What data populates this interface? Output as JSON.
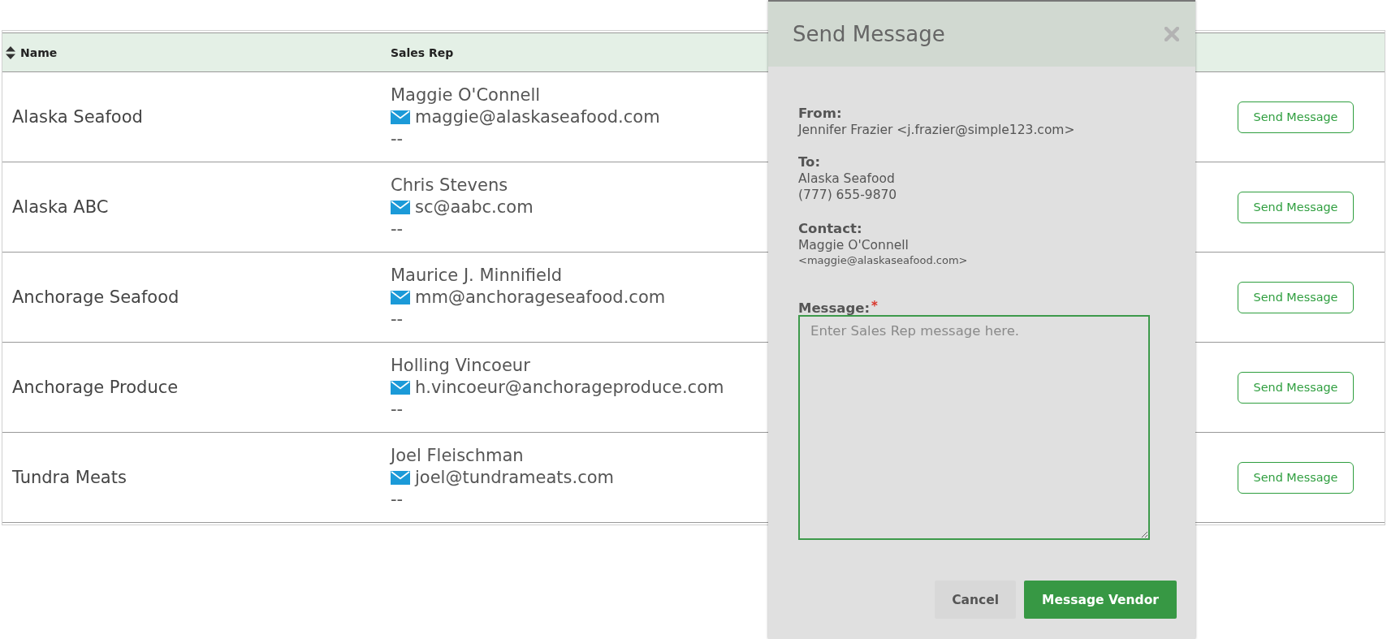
{
  "table": {
    "columns": [
      {
        "label": "Name",
        "sortable": true
      },
      {
        "label": "Sales Rep"
      }
    ],
    "rows": [
      {
        "name": "Alaska Seafood",
        "rep_name": "Maggie O'Connell",
        "rep_email": "maggie@alaskaseafood.com",
        "rep_phone": "--",
        "action": "Send Message"
      },
      {
        "name": "Alaska ABC",
        "rep_name": "Chris Stevens",
        "rep_email": "sc@aabc.com",
        "rep_phone": "--",
        "action": "Send Message"
      },
      {
        "name": "Anchorage Seafood",
        "rep_name": "Maurice J. Minnifield",
        "rep_email": "mm@anchorageseafood.com",
        "rep_phone": "--",
        "action": "Send Message"
      },
      {
        "name": "Anchorage Produce",
        "rep_name": "Holling Vincoeur",
        "rep_email": "h.vincoeur@anchorageproduce.com",
        "rep_phone": "--",
        "action": "Send Message"
      },
      {
        "name": "Tundra Meats",
        "rep_name": "Joel Fleischman",
        "rep_email": "joel@tundrameats.com",
        "rep_phone": "--",
        "action": "Send Message"
      }
    ]
  },
  "dialog": {
    "title": "Send Message",
    "from": {
      "label": "From:",
      "value": "Jennifer Frazier <j.frazier@simple123.com>"
    },
    "to": {
      "label": "To:",
      "lines": [
        "Alaska Seafood",
        "(777) 655-9870"
      ]
    },
    "contact": {
      "label": "Contact:",
      "name": "Maggie O'Connell",
      "email": "<maggie@alaskaseafood.com>"
    },
    "message": {
      "label": "Message:",
      "required_mark": "*",
      "placeholder": "Enter Sales Rep message here.",
      "focused": true
    },
    "buttons": [
      {
        "label": "Cancel",
        "kind": "secondary"
      },
      {
        "label": "Message Vendor",
        "kind": "primary"
      }
    ]
  }
}
